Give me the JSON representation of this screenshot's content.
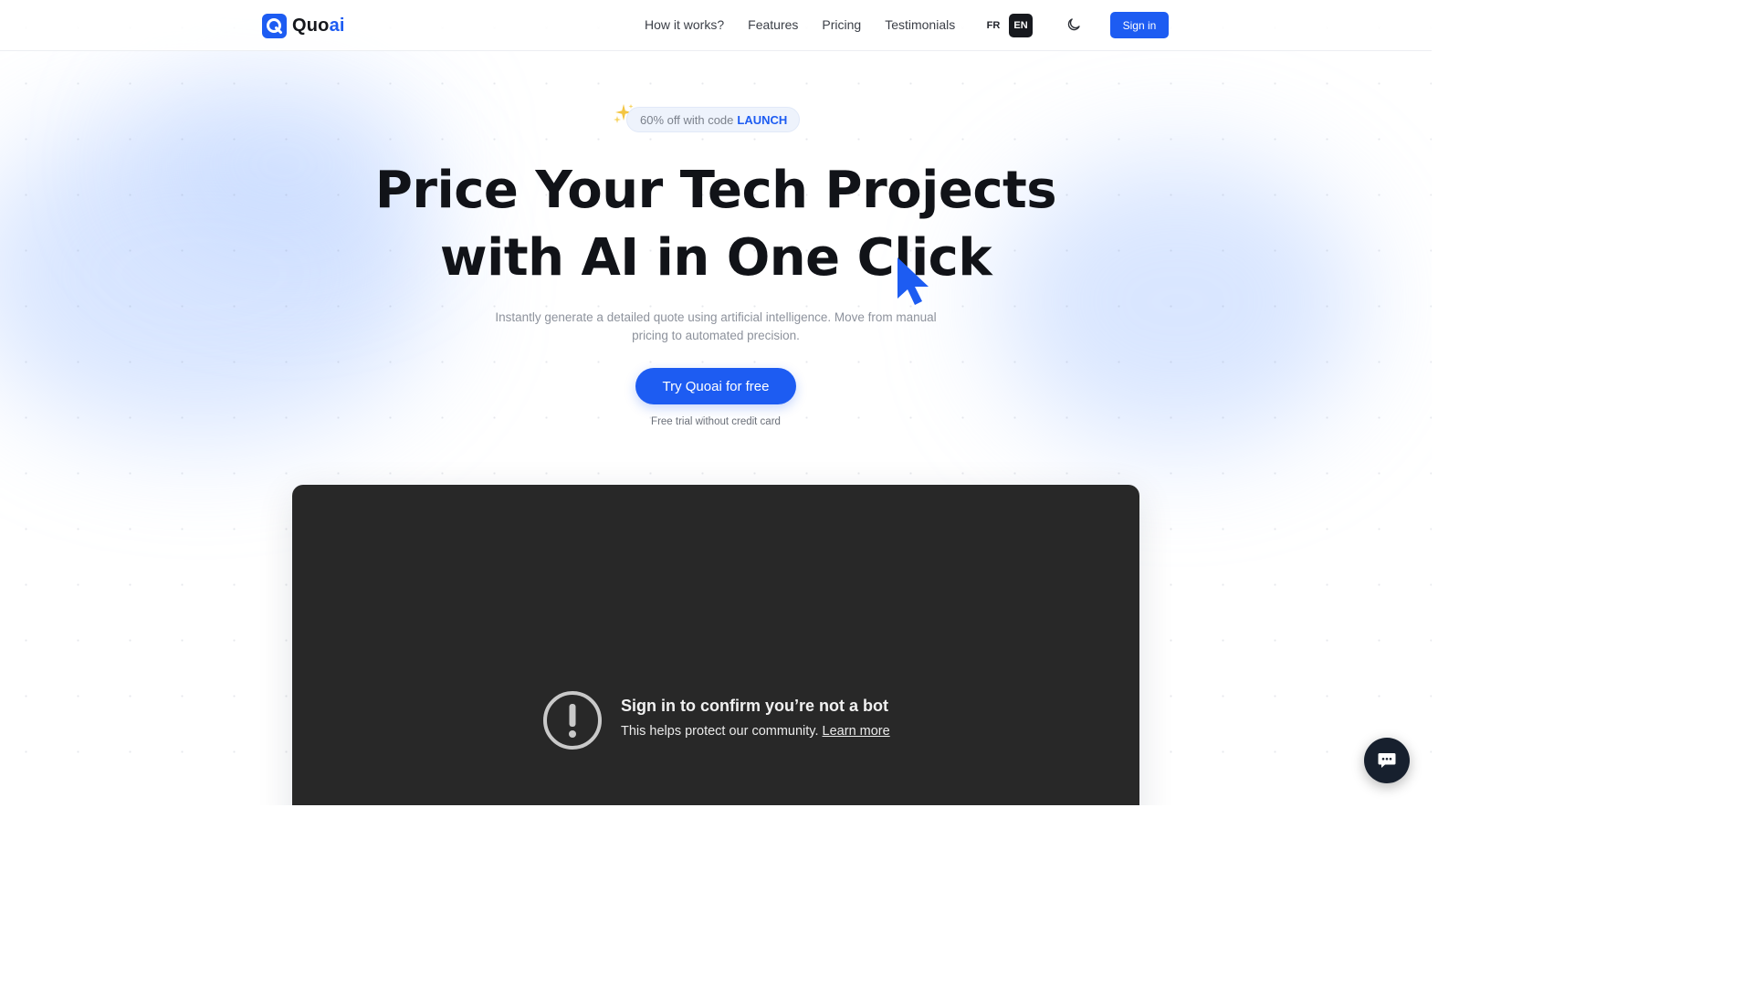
{
  "brand": {
    "name_main": "Quo",
    "name_accent": "ai",
    "accent_color": "#1d5cf2"
  },
  "nav": {
    "items": [
      {
        "label": "How it works?"
      },
      {
        "label": "Features"
      },
      {
        "label": "Pricing"
      },
      {
        "label": "Testimonials"
      }
    ]
  },
  "language": {
    "options": [
      "FR",
      "EN"
    ],
    "selected": "EN"
  },
  "header": {
    "theme_icon": "moon-icon",
    "signin_label": "Sign in"
  },
  "hero": {
    "promo_text": "60% off with code",
    "promo_code": "LAUNCH",
    "title_line1": "Price Your Tech Projects",
    "title_line2": "with AI in One Click",
    "subtitle": "Instantly generate a detailed quote using artificial intelligence. Move from manual pricing to automated precision.",
    "cta_label": "Try Quoai for free",
    "cta_note": "Free trial without credit card"
  },
  "video": {
    "background": "#282828",
    "icon": "exclamation-circle-icon",
    "title": "Sign in to confirm you’re not a bot",
    "message": "This helps protect our community.",
    "link": "Learn more"
  },
  "chat": {
    "icon": "chat-bubble-icon",
    "color": "#17202e"
  }
}
